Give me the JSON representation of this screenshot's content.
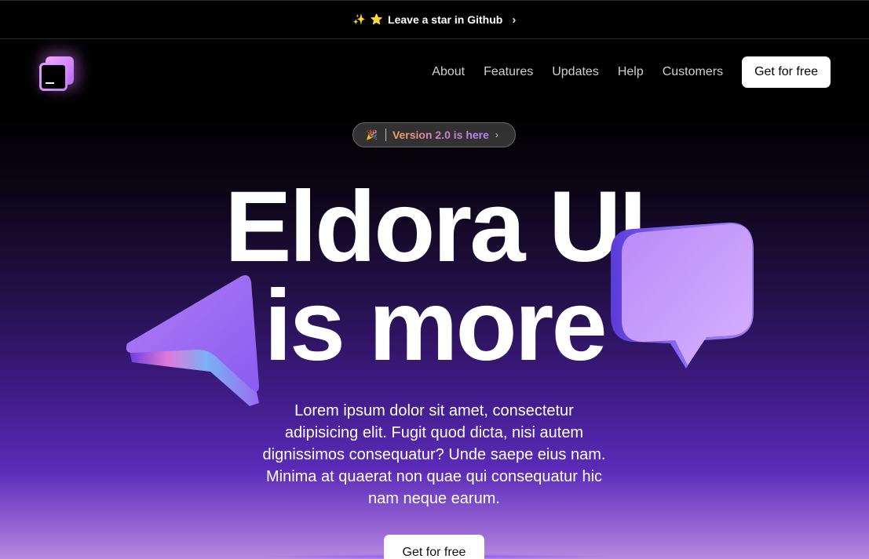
{
  "banner": {
    "emoji_left": "✨",
    "emoji_star": "⭐",
    "label": "Leave a star in Github",
    "chevron": "›"
  },
  "nav": {
    "items": [
      "About",
      "Features",
      "Updates",
      "Help",
      "Customers"
    ],
    "cta": "Get for free"
  },
  "pill": {
    "icon": "🎉",
    "label": "Version 2.0 is here",
    "chevron": "›"
  },
  "hero": {
    "line1": "Eldora UI",
    "line2": "is more",
    "description": "Lorem ipsum dolor sit amet, consectetur adipisicing elit. Fugit quod dicta, nisi autem dignissimos consequatur? Unde saepe eius nam. Minima at quaerat non quae qui consequatur hic nam neque earum.",
    "cta": "Get for free"
  },
  "colors": {
    "accent_purple": "#b489f0",
    "bg_dark": "#000000",
    "bg_purple": "#5b2bb8"
  }
}
